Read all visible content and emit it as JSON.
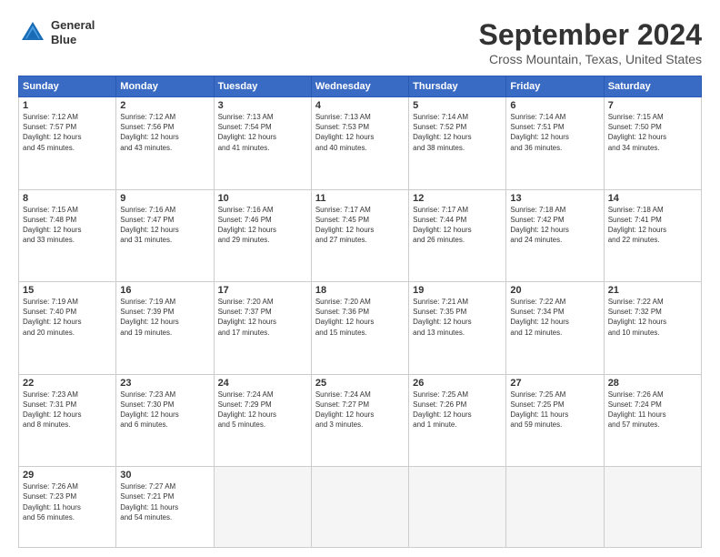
{
  "header": {
    "logo_line1": "General",
    "logo_line2": "Blue",
    "month": "September 2024",
    "location": "Cross Mountain, Texas, United States"
  },
  "weekdays": [
    "Sunday",
    "Monday",
    "Tuesday",
    "Wednesday",
    "Thursday",
    "Friday",
    "Saturday"
  ],
  "weeks": [
    [
      {
        "day": "1",
        "info": "Sunrise: 7:12 AM\nSunset: 7:57 PM\nDaylight: 12 hours\nand 45 minutes."
      },
      {
        "day": "2",
        "info": "Sunrise: 7:12 AM\nSunset: 7:56 PM\nDaylight: 12 hours\nand 43 minutes."
      },
      {
        "day": "3",
        "info": "Sunrise: 7:13 AM\nSunset: 7:54 PM\nDaylight: 12 hours\nand 41 minutes."
      },
      {
        "day": "4",
        "info": "Sunrise: 7:13 AM\nSunset: 7:53 PM\nDaylight: 12 hours\nand 40 minutes."
      },
      {
        "day": "5",
        "info": "Sunrise: 7:14 AM\nSunset: 7:52 PM\nDaylight: 12 hours\nand 38 minutes."
      },
      {
        "day": "6",
        "info": "Sunrise: 7:14 AM\nSunset: 7:51 PM\nDaylight: 12 hours\nand 36 minutes."
      },
      {
        "day": "7",
        "info": "Sunrise: 7:15 AM\nSunset: 7:50 PM\nDaylight: 12 hours\nand 34 minutes."
      }
    ],
    [
      {
        "day": "8",
        "info": "Sunrise: 7:15 AM\nSunset: 7:48 PM\nDaylight: 12 hours\nand 33 minutes."
      },
      {
        "day": "9",
        "info": "Sunrise: 7:16 AM\nSunset: 7:47 PM\nDaylight: 12 hours\nand 31 minutes."
      },
      {
        "day": "10",
        "info": "Sunrise: 7:16 AM\nSunset: 7:46 PM\nDaylight: 12 hours\nand 29 minutes."
      },
      {
        "day": "11",
        "info": "Sunrise: 7:17 AM\nSunset: 7:45 PM\nDaylight: 12 hours\nand 27 minutes."
      },
      {
        "day": "12",
        "info": "Sunrise: 7:17 AM\nSunset: 7:44 PM\nDaylight: 12 hours\nand 26 minutes."
      },
      {
        "day": "13",
        "info": "Sunrise: 7:18 AM\nSunset: 7:42 PM\nDaylight: 12 hours\nand 24 minutes."
      },
      {
        "day": "14",
        "info": "Sunrise: 7:18 AM\nSunset: 7:41 PM\nDaylight: 12 hours\nand 22 minutes."
      }
    ],
    [
      {
        "day": "15",
        "info": "Sunrise: 7:19 AM\nSunset: 7:40 PM\nDaylight: 12 hours\nand 20 minutes."
      },
      {
        "day": "16",
        "info": "Sunrise: 7:19 AM\nSunset: 7:39 PM\nDaylight: 12 hours\nand 19 minutes."
      },
      {
        "day": "17",
        "info": "Sunrise: 7:20 AM\nSunset: 7:37 PM\nDaylight: 12 hours\nand 17 minutes."
      },
      {
        "day": "18",
        "info": "Sunrise: 7:20 AM\nSunset: 7:36 PM\nDaylight: 12 hours\nand 15 minutes."
      },
      {
        "day": "19",
        "info": "Sunrise: 7:21 AM\nSunset: 7:35 PM\nDaylight: 12 hours\nand 13 minutes."
      },
      {
        "day": "20",
        "info": "Sunrise: 7:22 AM\nSunset: 7:34 PM\nDaylight: 12 hours\nand 12 minutes."
      },
      {
        "day": "21",
        "info": "Sunrise: 7:22 AM\nSunset: 7:32 PM\nDaylight: 12 hours\nand 10 minutes."
      }
    ],
    [
      {
        "day": "22",
        "info": "Sunrise: 7:23 AM\nSunset: 7:31 PM\nDaylight: 12 hours\nand 8 minutes."
      },
      {
        "day": "23",
        "info": "Sunrise: 7:23 AM\nSunset: 7:30 PM\nDaylight: 12 hours\nand 6 minutes."
      },
      {
        "day": "24",
        "info": "Sunrise: 7:24 AM\nSunset: 7:29 PM\nDaylight: 12 hours\nand 5 minutes."
      },
      {
        "day": "25",
        "info": "Sunrise: 7:24 AM\nSunset: 7:27 PM\nDaylight: 12 hours\nand 3 minutes."
      },
      {
        "day": "26",
        "info": "Sunrise: 7:25 AM\nSunset: 7:26 PM\nDaylight: 12 hours\nand 1 minute."
      },
      {
        "day": "27",
        "info": "Sunrise: 7:25 AM\nSunset: 7:25 PM\nDaylight: 11 hours\nand 59 minutes."
      },
      {
        "day": "28",
        "info": "Sunrise: 7:26 AM\nSunset: 7:24 PM\nDaylight: 11 hours\nand 57 minutes."
      }
    ],
    [
      {
        "day": "29",
        "info": "Sunrise: 7:26 AM\nSunset: 7:23 PM\nDaylight: 11 hours\nand 56 minutes."
      },
      {
        "day": "30",
        "info": "Sunrise: 7:27 AM\nSunset: 7:21 PM\nDaylight: 11 hours\nand 54 minutes."
      },
      null,
      null,
      null,
      null,
      null
    ]
  ]
}
